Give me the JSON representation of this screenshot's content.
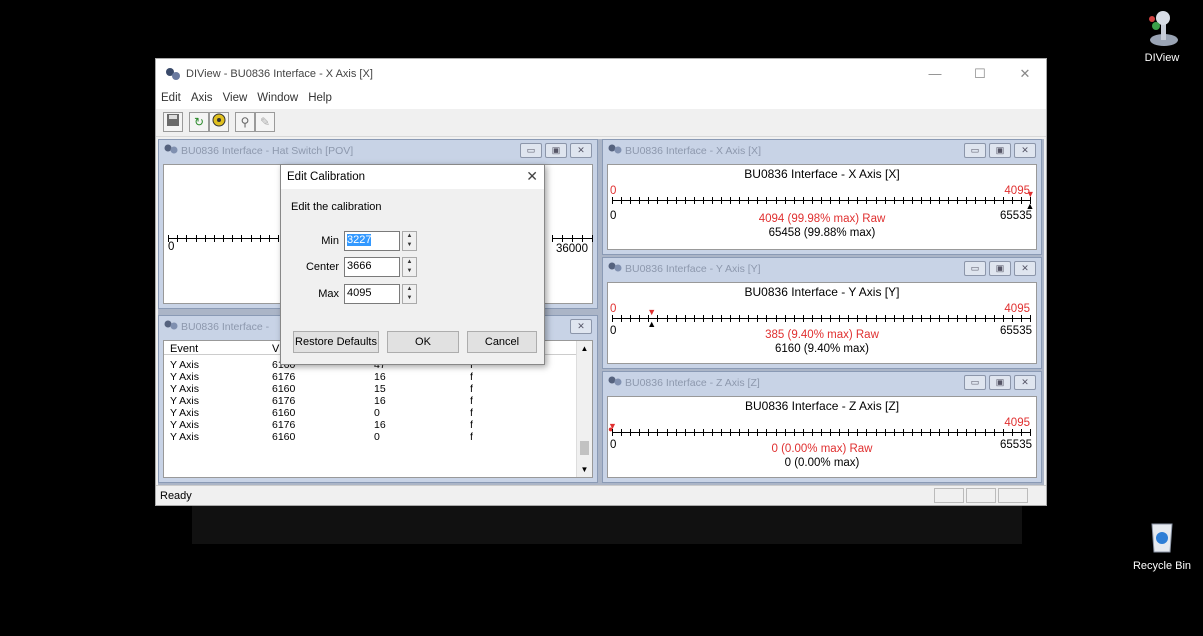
{
  "desktop": {
    "icons": [
      {
        "label": "DIView",
        "icon": "joystick-icon"
      },
      {
        "label": "Recycle Bin",
        "icon": "recycle-bin-icon"
      }
    ]
  },
  "window": {
    "title": "DIView - BU0836 Interface - X Axis [X]",
    "controls": {
      "minimize": "—",
      "maximize": "☐",
      "close": "✕"
    },
    "menu": [
      "Edit",
      "Axis",
      "View",
      "Window",
      "Help"
    ],
    "status": "Ready"
  },
  "hat": {
    "title": "BU0836 Interface - Hat Switch [POV]",
    "min_label": "0",
    "max_label": "36000"
  },
  "events": {
    "title": "BU0836 Interface -",
    "columns": [
      "Event",
      "V"
    ],
    "rows": [
      [
        "Y Axis",
        "6160",
        "47",
        "f"
      ],
      [
        "Y Axis",
        "6176",
        "16",
        "f"
      ],
      [
        "Y Axis",
        "6160",
        "15",
        "f"
      ],
      [
        "Y Axis",
        "6176",
        "16",
        "f"
      ],
      [
        "Y Axis",
        "6160",
        "0",
        "f"
      ],
      [
        "Y Axis",
        "6176",
        "16",
        "f"
      ],
      [
        "Y Axis",
        "6160",
        "0",
        "f"
      ]
    ]
  },
  "x_axis": {
    "title": "BU0836 Interface - X Axis [X]",
    "heading": "BU0836 Interface - X Axis [X]",
    "raw_min": "0",
    "raw_max": "4095",
    "min": "0",
    "max": "65535",
    "raw_text": "4094 (99.98% max)  Raw",
    "value_text": "65458 (99.88% max)",
    "raw_fraction": 0.9998,
    "value_fraction": 0.9988
  },
  "y_axis": {
    "title": "BU0836 Interface - Y Axis [Y]",
    "heading": "BU0836 Interface - Y Axis [Y]",
    "raw_min": "0",
    "raw_max": "4095",
    "min": "0",
    "max": "65535",
    "raw_text": "385 (9.40% max)  Raw",
    "value_text": "6160 (9.40% max)",
    "raw_fraction": 0.094,
    "value_fraction": 0.094
  },
  "z_axis": {
    "title": "BU0836 Interface - Z Axis [Z]",
    "heading": "BU0836 Interface - Z Axis [Z]",
    "raw_min": "",
    "raw_max": "4095",
    "min": "0",
    "max": "65535",
    "raw_text": "0 (0.00% max)  Raw",
    "value_text": "0 (0.00% max)",
    "raw_fraction": 0.0,
    "value_fraction": 0.0
  },
  "dialog": {
    "title": "Edit Calibration",
    "subtitle": "Edit the calibration",
    "min_label": "Min",
    "min_value": "3227",
    "center_label": "Center",
    "center_value": "3666",
    "max_label": "Max",
    "max_value": "4095",
    "restore_label": "Restore Defaults",
    "ok_label": "OK",
    "cancel_label": "Cancel",
    "close": "✕"
  },
  "colors": {
    "raw": "#e03030",
    "mdi_bg": "#abb5c7"
  }
}
